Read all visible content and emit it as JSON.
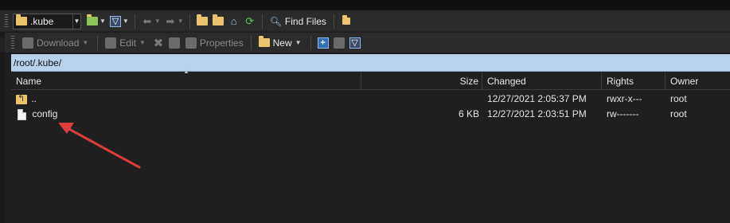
{
  "toolbar_top": {
    "location": ".kube",
    "find_files_label": "Find Files"
  },
  "toolbar_bottom": {
    "download_label": "Download",
    "edit_label": "Edit",
    "properties_label": "Properties",
    "new_label": "New"
  },
  "path": "/root/.kube/",
  "columns": {
    "name": "Name",
    "size": "Size",
    "changed": "Changed",
    "rights": "Rights",
    "owner": "Owner"
  },
  "files": [
    {
      "name": "..",
      "size": "",
      "changed": "12/27/2021 2:05:37 PM",
      "rights": "rwxr-x---",
      "owner": "root",
      "icon": "parent-folder-icon"
    },
    {
      "name": "config",
      "size": "6 KB",
      "changed": "12/27/2021 2:03:51 PM",
      "rights": "rw-------",
      "owner": "root",
      "icon": "file-icon"
    }
  ],
  "colors": {
    "path_bar": "#b9d1ea",
    "background": "#1f1f1f",
    "annotation_arrow": "#e03c3c"
  }
}
